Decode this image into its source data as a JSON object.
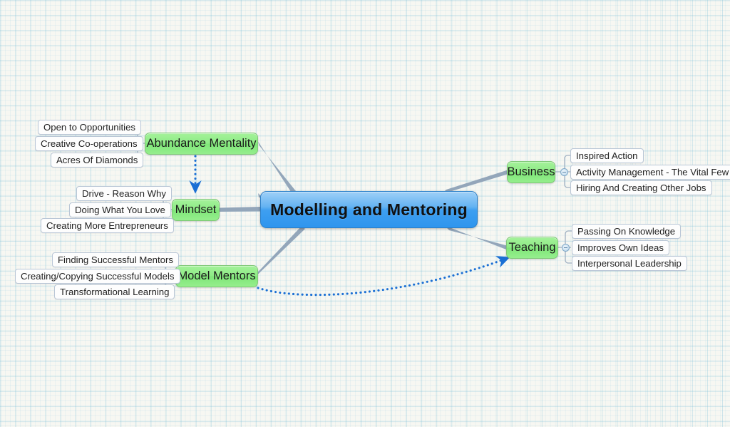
{
  "document": {
    "title": "Modelling and Mentoring",
    "type": "mind-map"
  },
  "colors": {
    "root_fill": "#3e9ff0",
    "branch_fill": "#8eeb86",
    "leaf_fill": "#fdfdfd",
    "connector": "#8fa3b8",
    "relation_arrow": "#1a6fd4",
    "grid_line": "#78bed7",
    "canvas_bg": "#f7f7f2"
  },
  "root": {
    "label": "Modelling and Mentoring"
  },
  "branches": [
    {
      "id": "abundance-mentality",
      "label": "Abundance Mentality",
      "side": "left",
      "children": [
        {
          "label": "Open to Opportunities"
        },
        {
          "label": "Creative Co-operations"
        },
        {
          "label": "Acres Of Diamonds"
        }
      ]
    },
    {
      "id": "mindset",
      "label": "Mindset",
      "side": "left",
      "children": [
        {
          "label": "Drive - Reason Why"
        },
        {
          "label": "Doing What You Love"
        },
        {
          "label": "Creating More Entrepreneurs"
        }
      ]
    },
    {
      "id": "model-mentors",
      "label": "Model Mentors",
      "side": "left",
      "children": [
        {
          "label": "Finding Successful Mentors"
        },
        {
          "label": "Creating/Copying Successful Models"
        },
        {
          "label": "Transformational Learning"
        }
      ]
    },
    {
      "id": "business",
      "label": "Business",
      "side": "right",
      "children": [
        {
          "label": "Inspired Action"
        },
        {
          "label": "Activity Management - The Vital Few"
        },
        {
          "label": "Hiring And Creating Other Jobs"
        }
      ]
    },
    {
      "id": "teaching",
      "label": "Teaching",
      "side": "right",
      "children": [
        {
          "label": "Passing On Knowledge"
        },
        {
          "label": "Improves Own Ideas"
        },
        {
          "label": "Interpersonal Leadership"
        }
      ]
    }
  ],
  "relationships": [
    {
      "id": "abundance-to-mindset",
      "from": "abundance-mentality",
      "to": "mindset",
      "style": "dotted-arrow"
    },
    {
      "id": "mentors-to-teaching",
      "from": "model-mentors",
      "to": "teaching",
      "style": "dotted-arrow"
    }
  ]
}
